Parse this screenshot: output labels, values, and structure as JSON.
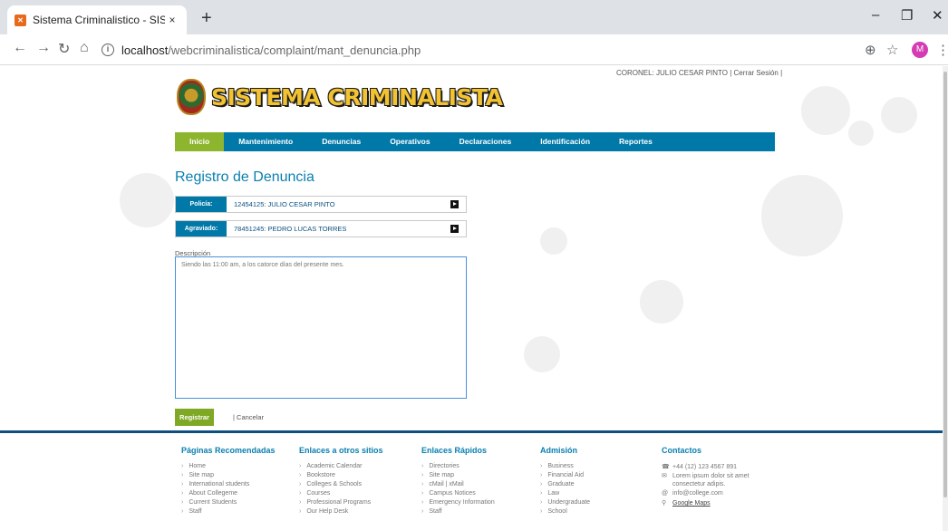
{
  "browser": {
    "tab_title": "Sistema Criminalistico - SISCrimi",
    "tab_close": "×",
    "new_tab": "+",
    "url_host": "localhost",
    "url_path": "/webcriminalistica/complaint/mant_denuncia.php",
    "avatar_letter": "M"
  },
  "header": {
    "user_info": "CORONEL: JULIO CESAR PINTO | Cerrar Sesión |",
    "logo_text": "SISTEMA CRIMINALISTA"
  },
  "nav": {
    "items": [
      "Inicio",
      "Mantenimiento",
      "Denuncias",
      "Operativos",
      "Declaraciones",
      "Identificación",
      "Reportes"
    ]
  },
  "form": {
    "title": "Registro de Denuncia",
    "police_label": "Policía:",
    "police_value": "12454125: JULIO CESAR PINTO",
    "victim_label": "Agraviado:",
    "victim_value": "78451245: PEDRO LUCAS TORRES",
    "description_label": "Descripción",
    "description_value": "Siendo las 11:00 am, a los catorce días del presente mes.",
    "submit_label": "Registrar",
    "cancel_label": "| Cancelar"
  },
  "footer": {
    "recommended": {
      "title": "Páginas Recomendadas",
      "items": [
        "Home",
        "Site map",
        "International students",
        "About Collegeme",
        "Current Students",
        "Staff"
      ]
    },
    "links": {
      "title": "Enlaces a otros sitios",
      "items": [
        "Academic Calendar",
        "Bookstore",
        "Colleges & Schools",
        "Courses",
        "Professional Programs",
        "Our Help Desk"
      ]
    },
    "quick": {
      "title": "Enlaces Rápidos",
      "items": [
        "Directories",
        "Site map",
        "cMail | xMail",
        "Campus Notices",
        "Emergency Information",
        "Staff"
      ]
    },
    "admission": {
      "title": "Admisión",
      "items": [
        "Business",
        "Financial Aid",
        "Graduate",
        "Law",
        "Undergraduate",
        "School"
      ]
    },
    "contacts": {
      "title": "Contactos",
      "phone": "+44 (12) 123 4567 891",
      "address_line1": "Lorem ipsum dolor sit amet",
      "address_line2": "consectetur adipis.",
      "email": "info@college.com",
      "maps": "Google Maps"
    }
  }
}
